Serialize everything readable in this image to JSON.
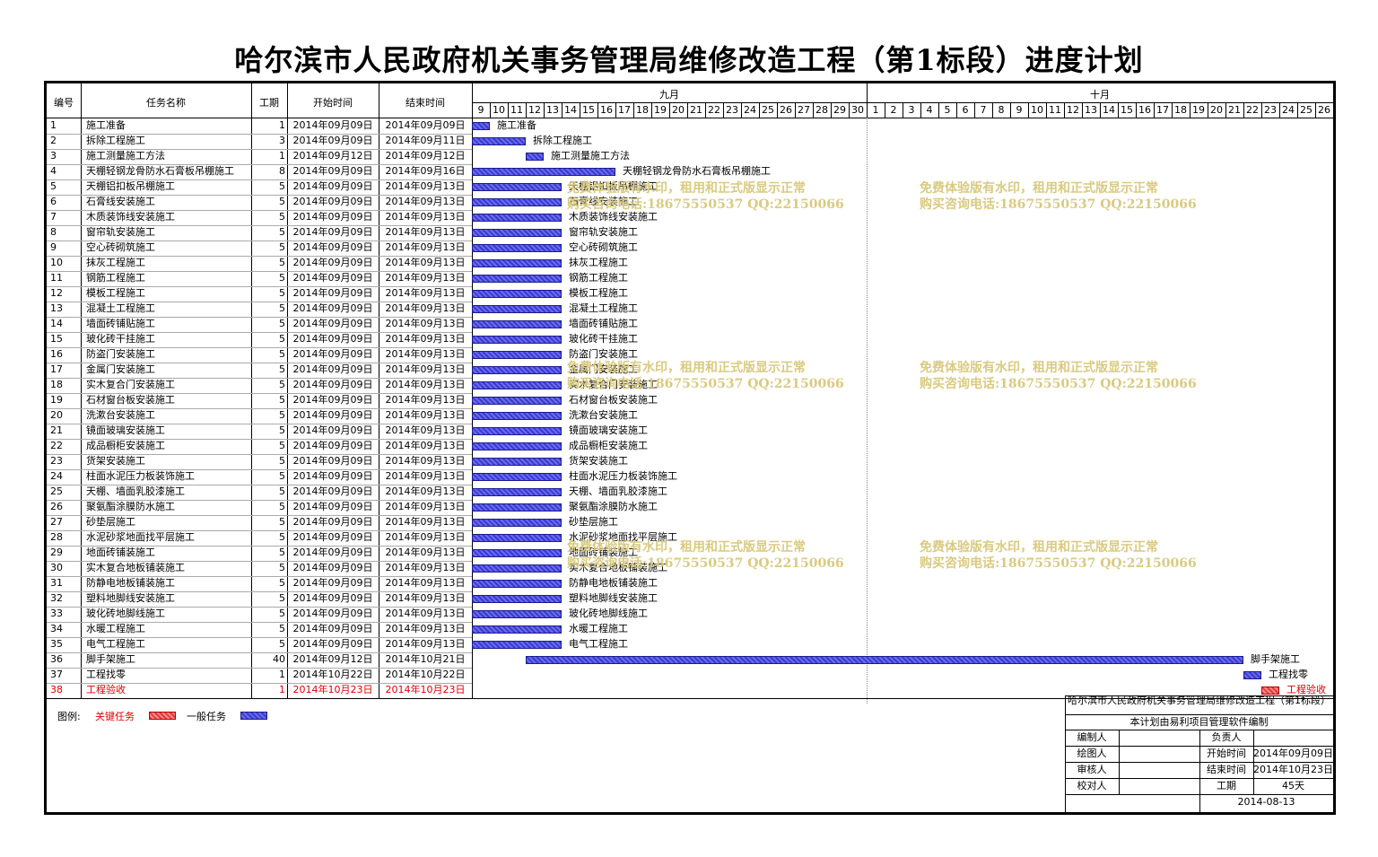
{
  "title": "哈尔滨市人民政府机关事务管理局维修改造工程（第1标段）进度计划",
  "columns": {
    "id": "编号",
    "name": "任务名称",
    "duration": "工期",
    "start": "开始时间",
    "end": "结束时间"
  },
  "timeline": {
    "months": [
      {
        "label": "九月",
        "days": [
          9,
          10,
          11,
          12,
          13,
          14,
          15,
          16,
          17,
          18,
          19,
          20,
          21,
          22,
          23,
          24,
          25,
          26,
          27,
          28,
          29,
          30
        ]
      },
      {
        "label": "十月",
        "days": [
          1,
          2,
          3,
          4,
          5,
          6,
          7,
          8,
          9,
          10,
          11,
          12,
          13,
          14,
          15,
          16,
          17,
          18,
          19,
          20,
          21,
          22,
          23,
          24,
          25,
          26
        ]
      }
    ]
  },
  "tasks": [
    {
      "id": "1",
      "name": "施工准备",
      "duration": "1",
      "start": "2014年09月09日",
      "end": "2014年09月09日",
      "offset": 0,
      "days": 1,
      "critical": false
    },
    {
      "id": "2",
      "name": "拆除工程施工",
      "duration": "3",
      "start": "2014年09月09日",
      "end": "2014年09月11日",
      "offset": 0,
      "days": 3,
      "critical": false
    },
    {
      "id": "3",
      "name": "施工测量施工方法",
      "duration": "1",
      "start": "2014年09月12日",
      "end": "2014年09月12日",
      "offset": 3,
      "days": 1,
      "critical": false
    },
    {
      "id": "4",
      "name": "天棚轻钢龙骨防水石膏板吊棚施工",
      "duration": "8",
      "start": "2014年09月09日",
      "end": "2014年09月16日",
      "offset": 0,
      "days": 8,
      "critical": false
    },
    {
      "id": "5",
      "name": "天棚铝扣板吊棚施工",
      "duration": "5",
      "start": "2014年09月09日",
      "end": "2014年09月13日",
      "offset": 0,
      "days": 5,
      "critical": false
    },
    {
      "id": "6",
      "name": "石膏线安装施工",
      "duration": "5",
      "start": "2014年09月09日",
      "end": "2014年09月13日",
      "offset": 0,
      "days": 5,
      "critical": false
    },
    {
      "id": "7",
      "name": "木质装饰线安装施工",
      "duration": "5",
      "start": "2014年09月09日",
      "end": "2014年09月13日",
      "offset": 0,
      "days": 5,
      "critical": false
    },
    {
      "id": "8",
      "name": "窗帘轨安装施工",
      "duration": "5",
      "start": "2014年09月09日",
      "end": "2014年09月13日",
      "offset": 0,
      "days": 5,
      "critical": false
    },
    {
      "id": "9",
      "name": "空心砖砌筑施工",
      "duration": "5",
      "start": "2014年09月09日",
      "end": "2014年09月13日",
      "offset": 0,
      "days": 5,
      "critical": false
    },
    {
      "id": "10",
      "name": "抹灰工程施工",
      "duration": "5",
      "start": "2014年09月09日",
      "end": "2014年09月13日",
      "offset": 0,
      "days": 5,
      "critical": false
    },
    {
      "id": "11",
      "name": "钢筋工程施工",
      "duration": "5",
      "start": "2014年09月09日",
      "end": "2014年09月13日",
      "offset": 0,
      "days": 5,
      "critical": false
    },
    {
      "id": "12",
      "name": "模板工程施工",
      "duration": "5",
      "start": "2014年09月09日",
      "end": "2014年09月13日",
      "offset": 0,
      "days": 5,
      "critical": false
    },
    {
      "id": "13",
      "name": "混凝土工程施工",
      "duration": "5",
      "start": "2014年09月09日",
      "end": "2014年09月13日",
      "offset": 0,
      "days": 5,
      "critical": false
    },
    {
      "id": "14",
      "name": "墙面砖铺贴施工",
      "duration": "5",
      "start": "2014年09月09日",
      "end": "2014年09月13日",
      "offset": 0,
      "days": 5,
      "critical": false
    },
    {
      "id": "15",
      "name": "玻化砖干挂施工",
      "duration": "5",
      "start": "2014年09月09日",
      "end": "2014年09月13日",
      "offset": 0,
      "days": 5,
      "critical": false
    },
    {
      "id": "16",
      "name": "防盗门安装施工",
      "duration": "5",
      "start": "2014年09月09日",
      "end": "2014年09月13日",
      "offset": 0,
      "days": 5,
      "critical": false
    },
    {
      "id": "17",
      "name": "金属门安装施工",
      "duration": "5",
      "start": "2014年09月09日",
      "end": "2014年09月13日",
      "offset": 0,
      "days": 5,
      "critical": false
    },
    {
      "id": "18",
      "name": "实木复合门安装施工",
      "duration": "5",
      "start": "2014年09月09日",
      "end": "2014年09月13日",
      "offset": 0,
      "days": 5,
      "critical": false
    },
    {
      "id": "19",
      "name": "石材窗台板安装施工",
      "duration": "5",
      "start": "2014年09月09日",
      "end": "2014年09月13日",
      "offset": 0,
      "days": 5,
      "critical": false
    },
    {
      "id": "20",
      "name": "洗漱台安装施工",
      "duration": "5",
      "start": "2014年09月09日",
      "end": "2014年09月13日",
      "offset": 0,
      "days": 5,
      "critical": false
    },
    {
      "id": "21",
      "name": "镜面玻璃安装施工",
      "duration": "5",
      "start": "2014年09月09日",
      "end": "2014年09月13日",
      "offset": 0,
      "days": 5,
      "critical": false
    },
    {
      "id": "22",
      "name": "成品橱柜安装施工",
      "duration": "5",
      "start": "2014年09月09日",
      "end": "2014年09月13日",
      "offset": 0,
      "days": 5,
      "critical": false
    },
    {
      "id": "23",
      "name": "货架安装施工",
      "duration": "5",
      "start": "2014年09月09日",
      "end": "2014年09月13日",
      "offset": 0,
      "days": 5,
      "critical": false
    },
    {
      "id": "24",
      "name": "柱面水泥压力板装饰施工",
      "duration": "5",
      "start": "2014年09月09日",
      "end": "2014年09月13日",
      "offset": 0,
      "days": 5,
      "critical": false
    },
    {
      "id": "25",
      "name": "天棚、墙面乳胶漆施工",
      "duration": "5",
      "start": "2014年09月09日",
      "end": "2014年09月13日",
      "offset": 0,
      "days": 5,
      "critical": false
    },
    {
      "id": "26",
      "name": "聚氨酯涂膜防水施工",
      "duration": "5",
      "start": "2014年09月09日",
      "end": "2014年09月13日",
      "offset": 0,
      "days": 5,
      "critical": false
    },
    {
      "id": "27",
      "name": "砂垫层施工",
      "duration": "5",
      "start": "2014年09月09日",
      "end": "2014年09月13日",
      "offset": 0,
      "days": 5,
      "critical": false
    },
    {
      "id": "28",
      "name": "水泥砂浆地面找平层施工",
      "duration": "5",
      "start": "2014年09月09日",
      "end": "2014年09月13日",
      "offset": 0,
      "days": 5,
      "critical": false
    },
    {
      "id": "29",
      "name": "地面砖铺装施工",
      "duration": "5",
      "start": "2014年09月09日",
      "end": "2014年09月13日",
      "offset": 0,
      "days": 5,
      "critical": false
    },
    {
      "id": "30",
      "name": "实木复合地板铺装施工",
      "duration": "5",
      "start": "2014年09月09日",
      "end": "2014年09月13日",
      "offset": 0,
      "days": 5,
      "critical": false
    },
    {
      "id": "31",
      "name": "防静电地板铺装施工",
      "duration": "5",
      "start": "2014年09月09日",
      "end": "2014年09月13日",
      "offset": 0,
      "days": 5,
      "critical": false
    },
    {
      "id": "32",
      "name": "塑料地脚线安装施工",
      "duration": "5",
      "start": "2014年09月09日",
      "end": "2014年09月13日",
      "offset": 0,
      "days": 5,
      "critical": false
    },
    {
      "id": "33",
      "name": "玻化砖地脚线施工",
      "duration": "5",
      "start": "2014年09月09日",
      "end": "2014年09月13日",
      "offset": 0,
      "days": 5,
      "critical": false
    },
    {
      "id": "34",
      "name": "水暖工程施工",
      "duration": "5",
      "start": "2014年09月09日",
      "end": "2014年09月13日",
      "offset": 0,
      "days": 5,
      "critical": false
    },
    {
      "id": "35",
      "name": "电气工程施工",
      "duration": "5",
      "start": "2014年09月09日",
      "end": "2014年09月13日",
      "offset": 0,
      "days": 5,
      "critical": false
    },
    {
      "id": "36",
      "name": "脚手架施工",
      "duration": "40",
      "start": "2014年09月12日",
      "end": "2014年10月21日",
      "offset": 3,
      "days": 40,
      "critical": false
    },
    {
      "id": "37",
      "name": "工程找零",
      "duration": "1",
      "start": "2014年10月22日",
      "end": "2014年10月22日",
      "offset": 43,
      "days": 1,
      "critical": false
    },
    {
      "id": "38",
      "name": "工程验收",
      "duration": "1",
      "start": "2014年10月23日",
      "end": "2014年10月23日",
      "offset": 44,
      "days": 1,
      "critical": true
    }
  ],
  "watermark": {
    "line1": "免费体验版有水印，租用和正式版显示正常",
    "line2": "购买咨询电话:18675550537 QQ:22150066"
  },
  "legend": {
    "label": "图例:",
    "critical": "关键任务",
    "normal": "一般任务"
  },
  "colors": {
    "critical": "#e23b3b",
    "normal": "#3b3bcf",
    "watermark": "#d8c87a"
  },
  "info": {
    "project": "哈尔滨市人民政府机关事务管理局维修改造工程（第1标段）",
    "software": "本计划由易利项目管理软件编制",
    "compiler_label": "编制人",
    "compiler": "",
    "manager_label": "负责人",
    "manager": "",
    "drawer_label": "绘图人",
    "drawer": "",
    "start_label": "开始时间",
    "start": "2014年09月09日",
    "reviewer_label": "审核人",
    "reviewer": "",
    "end_label": "结束时间",
    "end": "2014年10月23日",
    "checker_label": "校对人",
    "checker": "",
    "duration_label": "工期",
    "duration": "45天",
    "date": "2014-08-13"
  }
}
